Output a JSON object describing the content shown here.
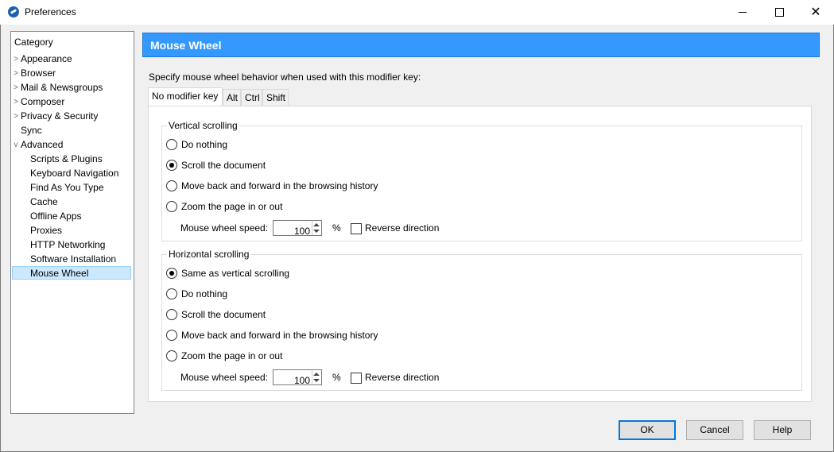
{
  "window": {
    "title": "Preferences"
  },
  "sidebar": {
    "title": "Category",
    "items": [
      {
        "label": "Appearance",
        "expandable": true
      },
      {
        "label": "Browser",
        "expandable": true
      },
      {
        "label": "Mail & Newsgroups",
        "expandable": true
      },
      {
        "label": "Composer",
        "expandable": true
      },
      {
        "label": "Privacy & Security",
        "expandable": true
      },
      {
        "label": "Sync",
        "expandable": false
      },
      {
        "label": "Advanced",
        "expandable": true,
        "expanded": true
      },
      {
        "label": "Scripts & Plugins"
      },
      {
        "label": "Keyboard Navigation"
      },
      {
        "label": "Find As You Type"
      },
      {
        "label": "Cache"
      },
      {
        "label": "Offline Apps"
      },
      {
        "label": "Proxies"
      },
      {
        "label": "HTTP Networking"
      },
      {
        "label": "Software Installation"
      },
      {
        "label": "Mouse Wheel",
        "selected": true
      }
    ]
  },
  "header": {
    "title": "Mouse Wheel"
  },
  "main": {
    "description": "Specify mouse wheel behavior when used with this modifier key:",
    "tabs": [
      "No modifier key",
      "Alt",
      "Ctrl",
      "Shift"
    ],
    "active_tab": "No modifier key",
    "vertical": {
      "title": "Vertical scrolling",
      "options": [
        "Do nothing",
        "Scroll the document",
        "Move back and forward in the browsing history",
        "Zoom the page in or out"
      ],
      "selected": "Scroll the document",
      "speed_label": "Mouse wheel speed:",
      "speed_value": "100",
      "unit": "%",
      "reverse_label": "Reverse direction",
      "reverse_checked": false
    },
    "horizontal": {
      "title": "Horizontal scrolling",
      "options": [
        "Same as vertical scrolling",
        "Do nothing",
        "Scroll the document",
        "Move back and forward in the browsing history",
        "Zoom the page in or out"
      ],
      "selected": "Same as vertical scrolling",
      "speed_label": "Mouse wheel speed:",
      "speed_value": "100",
      "unit": "%",
      "reverse_label": "Reverse direction",
      "reverse_checked": false
    }
  },
  "buttons": {
    "ok": "OK",
    "cancel": "Cancel",
    "help": "Help"
  },
  "colors": {
    "header_bg": "#3399ff",
    "selection_bg": "#cce8ff",
    "default_button_border": "#0078d7"
  }
}
